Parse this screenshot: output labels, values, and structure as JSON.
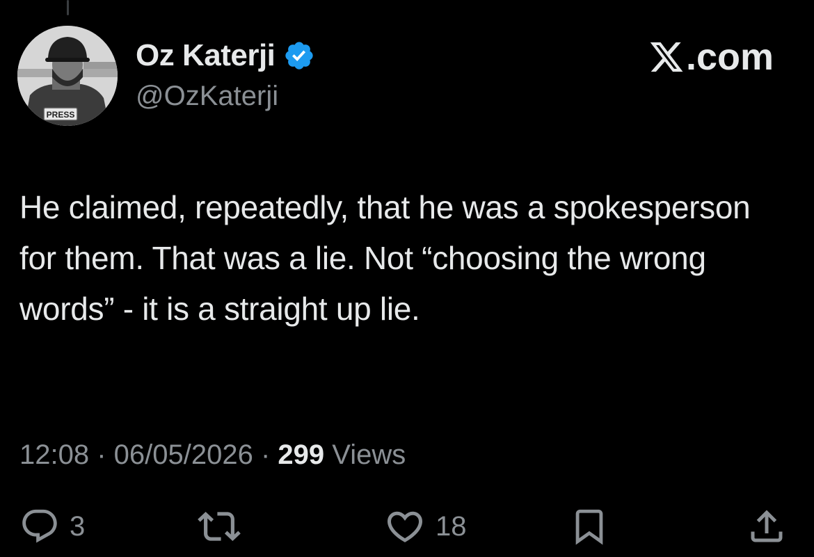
{
  "author": {
    "display_name": "Oz Katerji",
    "handle": "@OzKaterji",
    "verified": true,
    "verified_color": "#1d9bf0",
    "avatar_badge_text": "PRESS"
  },
  "brand": {
    "label": ".com",
    "icon": "x-logo-icon"
  },
  "tweet": {
    "text": "He claimed, repeatedly, that he was a spokesperson for them. That was a lie. Not “choosing the wrong words” - it is a straight up lie."
  },
  "meta": {
    "time": "12:08",
    "separator": " · ",
    "date": "06/05/2026",
    "views_count": "299",
    "views_label": " Views"
  },
  "actions": {
    "reply": {
      "icon": "reply-icon",
      "count": "3"
    },
    "retweet": {
      "icon": "retweet-icon",
      "count": ""
    },
    "like": {
      "icon": "heart-icon",
      "count": "18"
    },
    "bookmark": {
      "icon": "bookmark-icon"
    },
    "share": {
      "icon": "share-icon"
    }
  },
  "colors": {
    "background": "#000000",
    "primary_text": "#e7e9ea",
    "secondary_text": "#8b9095"
  }
}
